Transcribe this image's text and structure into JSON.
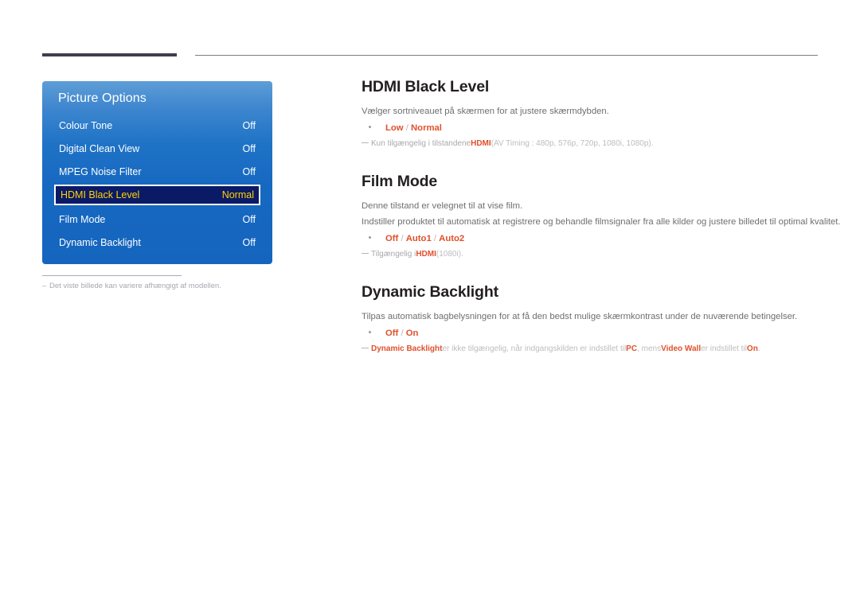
{
  "osd": {
    "title": "Picture Options",
    "rows": [
      {
        "label": "Colour Tone",
        "value": "Off",
        "selected": false
      },
      {
        "label": "Digital Clean View",
        "value": "Off",
        "selected": false
      },
      {
        "label": "MPEG Noise Filter",
        "value": "Off",
        "selected": false
      },
      {
        "label": "HDMI Black Level",
        "value": "Normal",
        "selected": true
      },
      {
        "label": "Film Mode",
        "value": "Off",
        "selected": false
      },
      {
        "label": "Dynamic Backlight",
        "value": "Off",
        "selected": false
      }
    ],
    "caption": "Det viste billede kan variere afhængigt af modellen.",
    "caption_dash": "–"
  },
  "sections": {
    "hdmi_black_level": {
      "heading": "HDMI Black Level",
      "desc": "Vælger sortniveauet på skærmen for at justere skærmdybden.",
      "options_prefix": "Low",
      "options_sep1": " / ",
      "options_1": "Normal",
      "note_pre": "Kun tilgængelig i tilstandene ",
      "note_bold": "HDMI",
      "note_post": " (AV Timing : 480p, 576p, 720p, 1080i, 1080p)."
    },
    "film_mode": {
      "heading": "Film Mode",
      "desc1": "Denne tilstand er velegnet til at vise film.",
      "desc2": "Indstiller produktet til automatisk at registrere og behandle filmsignaler fra alle kilder og justere billedet til optimal kvalitet.",
      "options_0": "Off",
      "options_sep1": " / ",
      "options_1": "Auto1",
      "options_sep2": " / ",
      "options_2": "Auto2",
      "note_pre": "Tilgængelig i ",
      "note_bold": "HDMI",
      "note_post": " (1080i)."
    },
    "dynamic_backlight": {
      "heading": "Dynamic Backlight",
      "desc": "Tilpas automatisk bagbelysningen for at få den bedst mulige skærmkontrast under de nuværende betingelser.",
      "options_0": "Off",
      "options_sep1": " / ",
      "options_1": "On",
      "note_b1": "Dynamic Backlight",
      "note_t1": " er ikke tilgængelig, når indgangskilden er indstillet til ",
      "note_b2": "PC",
      "note_t2": ", mens ",
      "note_b3": "Video Wall",
      "note_t3": " er indstillet til ",
      "note_b4": "On",
      "note_t4": "."
    }
  },
  "colors": {
    "accent_orange": "#e0502b",
    "osd_blue": "#1565bf",
    "osd_selected_bg": "#0b1a66",
    "osd_selected_text": "#ffd400",
    "heading": "#231f20",
    "body": "#6e6f73",
    "note": "#a9a9ae",
    "rule_dark": "#3f3d4f"
  }
}
